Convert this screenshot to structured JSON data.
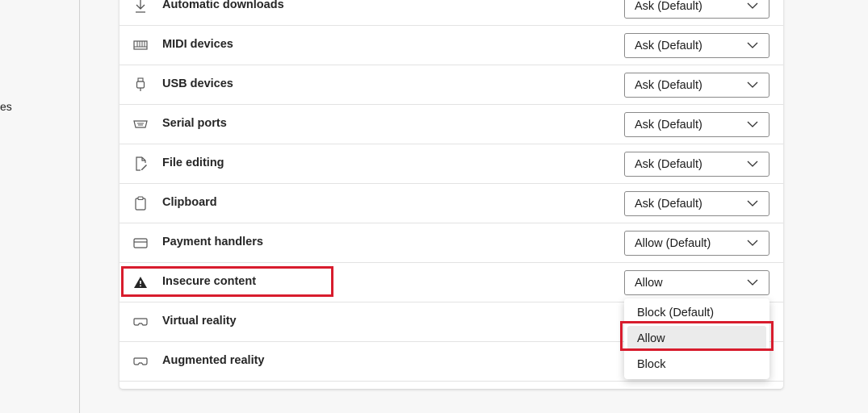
{
  "left_nav": {
    "partial_text": "es"
  },
  "rows": [
    {
      "label": "Automatic downloads",
      "icon": "download-icon",
      "value": "Ask (Default)"
    },
    {
      "label": "MIDI devices",
      "icon": "midi-keyboard-icon",
      "value": "Ask (Default)"
    },
    {
      "label": "USB devices",
      "icon": "usb-icon",
      "value": "Ask (Default)"
    },
    {
      "label": "Serial ports",
      "icon": "serial-port-icon",
      "value": "Ask (Default)"
    },
    {
      "label": "File editing",
      "icon": "file-edit-icon",
      "value": "Ask (Default)"
    },
    {
      "label": "Clipboard",
      "icon": "clipboard-icon",
      "value": "Ask (Default)"
    },
    {
      "label": "Payment handlers",
      "icon": "payment-card-icon",
      "value": "Allow (Default)"
    },
    {
      "label": "Insecure content",
      "icon": "warning-icon",
      "value": "Allow"
    },
    {
      "label": "Virtual reality",
      "icon": "vr-headset-icon",
      "value": ""
    },
    {
      "label": "Augmented reality",
      "icon": "ar-headset-icon",
      "value": ""
    }
  ],
  "dropdown": {
    "options": [
      "Block (Default)",
      "Allow",
      "Block"
    ],
    "selected": "Allow"
  },
  "colors": {
    "highlight": "#d81c2d",
    "border": "#8a8a8a"
  }
}
